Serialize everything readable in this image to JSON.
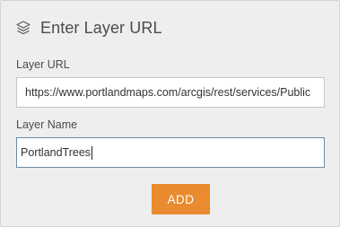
{
  "header": {
    "title": "Enter Layer URL",
    "icon": "layers-icon"
  },
  "form": {
    "url_label": "Layer URL",
    "url_value": "https://www.portlandmaps.com/arcgis/rest/services/Public",
    "name_label": "Layer Name",
    "name_value": "PortlandTrees"
  },
  "actions": {
    "add_label": "ADD"
  },
  "colors": {
    "panel_bg": "#eeeeee",
    "accent": "#e98b2e",
    "text": "#4c4c4c",
    "focus_border": "#6d8aa8"
  }
}
